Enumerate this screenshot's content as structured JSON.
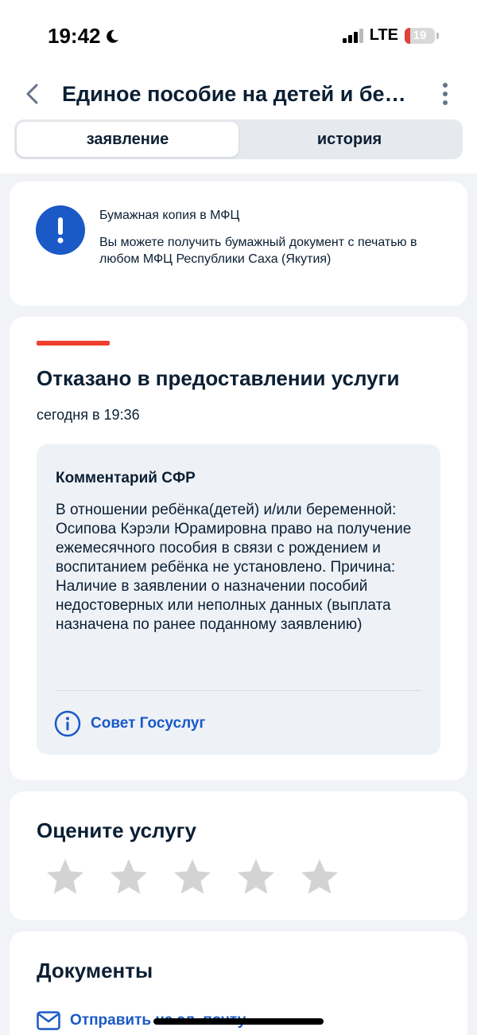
{
  "status_bar": {
    "time": "19:42",
    "network": "LTE",
    "battery": "19",
    "battery_level": 0.19,
    "colors": {
      "battery_low": "#e0423a"
    }
  },
  "header": {
    "title": "Единое пособие на детей и беременных",
    "back_icon": "chevron-left-icon",
    "menu_icon": "more-vertical-icon"
  },
  "tabs": [
    {
      "label": "заявление",
      "active": true
    },
    {
      "label": "история",
      "active": false
    }
  ],
  "info_card": {
    "icon": "exclamation-icon",
    "title": "Бумажная копия в МФЦ",
    "text": "Вы можете получить бумажный документ с печатью в любом МФЦ Республики Саха (Якутия)"
  },
  "status_card": {
    "title": "Отказано в предоставлении услуги",
    "date": "сегодня в 19:36",
    "comment": {
      "title": "Комментарий СФР",
      "text": "В отношении ребёнка(детей) и/или беременной: Осипова Кэрэли Юрамировна право на получение ежемесячного пособия в связи с рождением и воспитанием ребёнка не установлено. Причина: Наличие в заявлении о назначении пособий недостоверных или неполных данных (выплата назначена по ранее поданному заявлению)",
      "advice_label": "Совет Госуслуг",
      "advice_icon": "info-circle-icon"
    }
  },
  "rating": {
    "title": "Оцените услугу",
    "max_stars": 5,
    "selected": 0
  },
  "documents": {
    "title": "Документы",
    "email_label": "Отправить на эл. почту",
    "email_icon": "envelope-icon"
  },
  "colors": {
    "accent": "#1a59c6",
    "error": "#ee3f2f",
    "background": "#f1f3f6",
    "text": "#0b1f33",
    "star_inactive": "#d3d3d3"
  }
}
